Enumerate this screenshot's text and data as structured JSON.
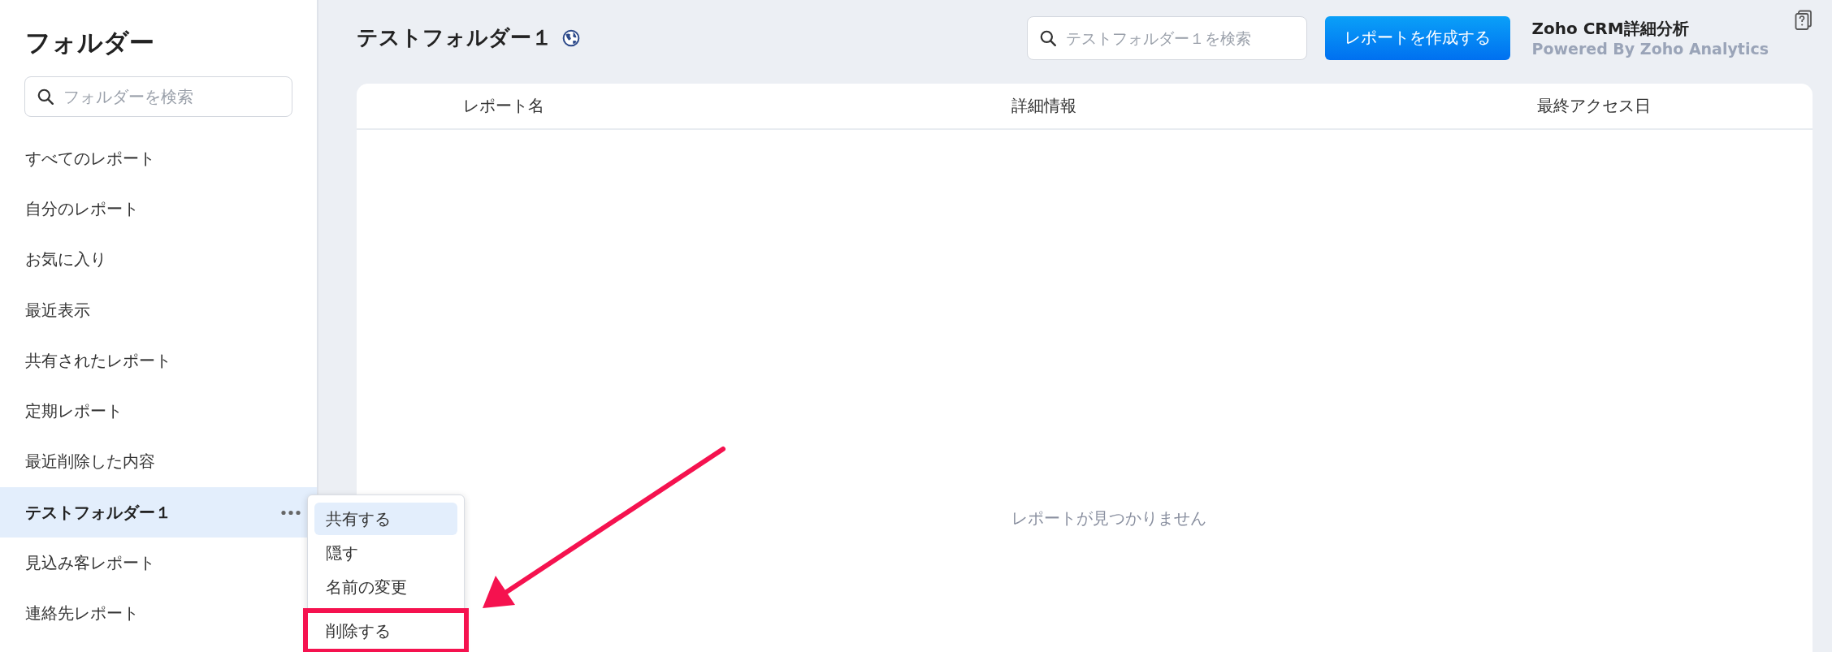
{
  "sidebar": {
    "title": "フォルダー",
    "search": {
      "placeholder": "フォルダーを検索"
    },
    "items": [
      {
        "label": "すべてのレポート",
        "selected": false
      },
      {
        "label": "自分のレポート",
        "selected": false
      },
      {
        "label": "お気に入り",
        "selected": false
      },
      {
        "label": "最近表示",
        "selected": false
      },
      {
        "label": "共有されたレポート",
        "selected": false
      },
      {
        "label": "定期レポート",
        "selected": false
      },
      {
        "label": "最近削除した内容",
        "selected": false
      },
      {
        "label": "テストフォルダー１",
        "selected": true
      },
      {
        "label": "見込み客レポート",
        "selected": false
      },
      {
        "label": "連絡先レポート",
        "selected": false
      }
    ]
  },
  "context_menu": {
    "items": [
      {
        "label": "共有する",
        "selected": true,
        "highlighted": false
      },
      {
        "label": "隠す",
        "selected": false,
        "highlighted": false
      },
      {
        "label": "名前の変更",
        "selected": false,
        "highlighted": false
      },
      {
        "label": "削除する",
        "selected": false,
        "highlighted": true
      }
    ]
  },
  "header": {
    "title": "テストフォルダー１",
    "search": {
      "placeholder": "テストフォルダー１を検索"
    },
    "create_button": "レポートを作成する",
    "app_name": "Zoho CRM詳細分析",
    "app_subtitle": "Powered By Zoho Analytics"
  },
  "table": {
    "columns": [
      "レポート名",
      "詳細情報",
      "最終アクセス日"
    ],
    "empty_message": "レポートが見つかりません"
  }
}
